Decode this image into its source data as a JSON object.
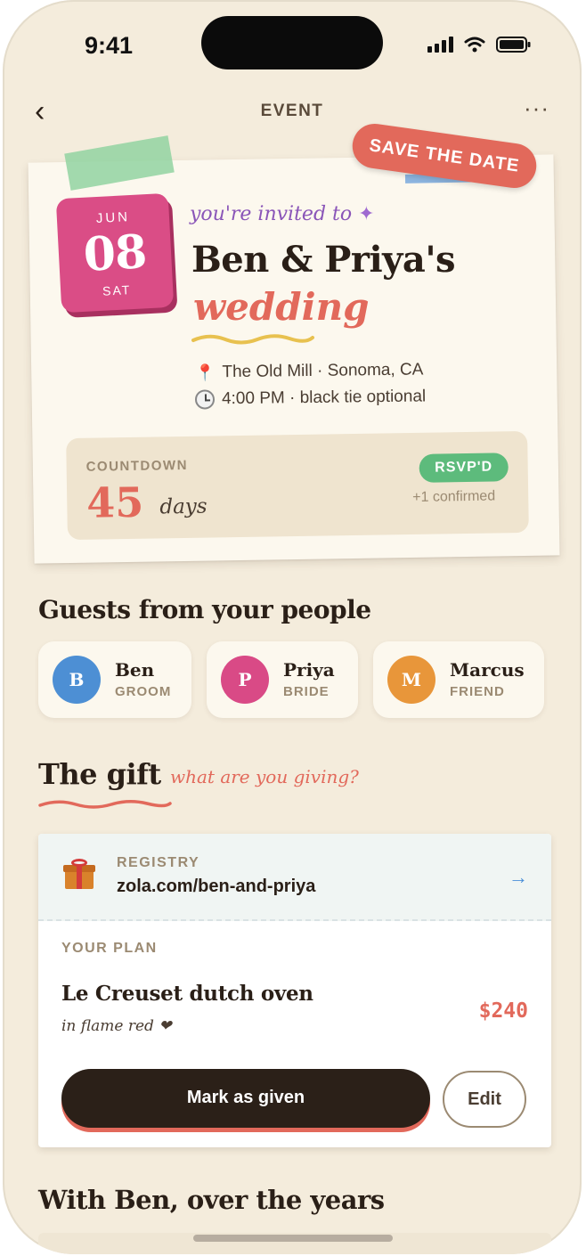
{
  "status_bar": {
    "time": "9:41"
  },
  "nav": {
    "back": "‹",
    "title": "EVENT",
    "more": "···"
  },
  "invite": {
    "stamp": "SAVE THE DATE",
    "date": {
      "month": "JUN",
      "day": "08",
      "weekday": "SAT"
    },
    "invited_text": "you're invited to",
    "couple": "Ben & Priya's",
    "event_type": "wedding",
    "venue": "The Old Mill · Sonoma, CA",
    "time_dress": "4:00 PM · black tie optional",
    "countdown": {
      "label": "COUNTDOWN",
      "number": "45",
      "unit": "days"
    },
    "rsvp_badge": "RSVP'D",
    "rsvp_note": "+1 confirmed"
  },
  "guests": {
    "heading": "Guests from your people",
    "people": [
      {
        "initial": "B",
        "name": "Ben",
        "role": "GROOM",
        "color": "#4d8fd4"
      },
      {
        "initial": "P",
        "name": "Priya",
        "role": "BRIDE",
        "color": "#d94a86"
      },
      {
        "initial": "M",
        "name": "Marcus",
        "role": "FRIEND",
        "color": "#e8963a"
      }
    ]
  },
  "gift": {
    "heading": "The gift",
    "subheading": "what are you giving?",
    "registry_label": "REGISTRY",
    "registry_url": "zola.com/ben-and-priya",
    "plan_label": "YOUR PLAN",
    "item": "Le Creuset dutch oven",
    "note": "in flame red ❤",
    "price": "$240",
    "primary_button": "Mark as given",
    "secondary_button": "Edit"
  },
  "history": {
    "heading": "With Ben, over the years"
  },
  "colors": {
    "accent": "#e2695b",
    "background": "#f4ecdc",
    "dark": "#2b2018",
    "green": "#5dbb7c"
  }
}
